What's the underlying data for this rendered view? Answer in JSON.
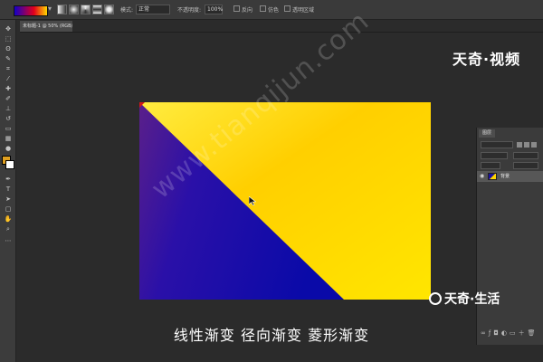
{
  "options_bar": {
    "mode_label": "模式:",
    "mode_value": "正常",
    "opacity_label": "不透明度:",
    "opacity_value": "100%",
    "reverse_label": "反向",
    "dither_label": "仿色",
    "transparency_label": "透明区域"
  },
  "document": {
    "tab_label": "未标题-1 @ 50% (RGB/8#) *"
  },
  "layers_panel": {
    "tab_label": "图层",
    "layer_name": "背景"
  },
  "logos": {
    "top": "天奇·视频",
    "bottom": "天奇·生活"
  },
  "watermark_text": "www.tianqijun.com",
  "subtitle": "线性渐变 径向渐变 菱形渐变",
  "colors": {
    "gradient_blue": "#1a0ea8",
    "gradient_yellow": "#ffd400",
    "gradient_red": "#d01818",
    "foreground": "#e0a020",
    "background": "#ffffff"
  }
}
